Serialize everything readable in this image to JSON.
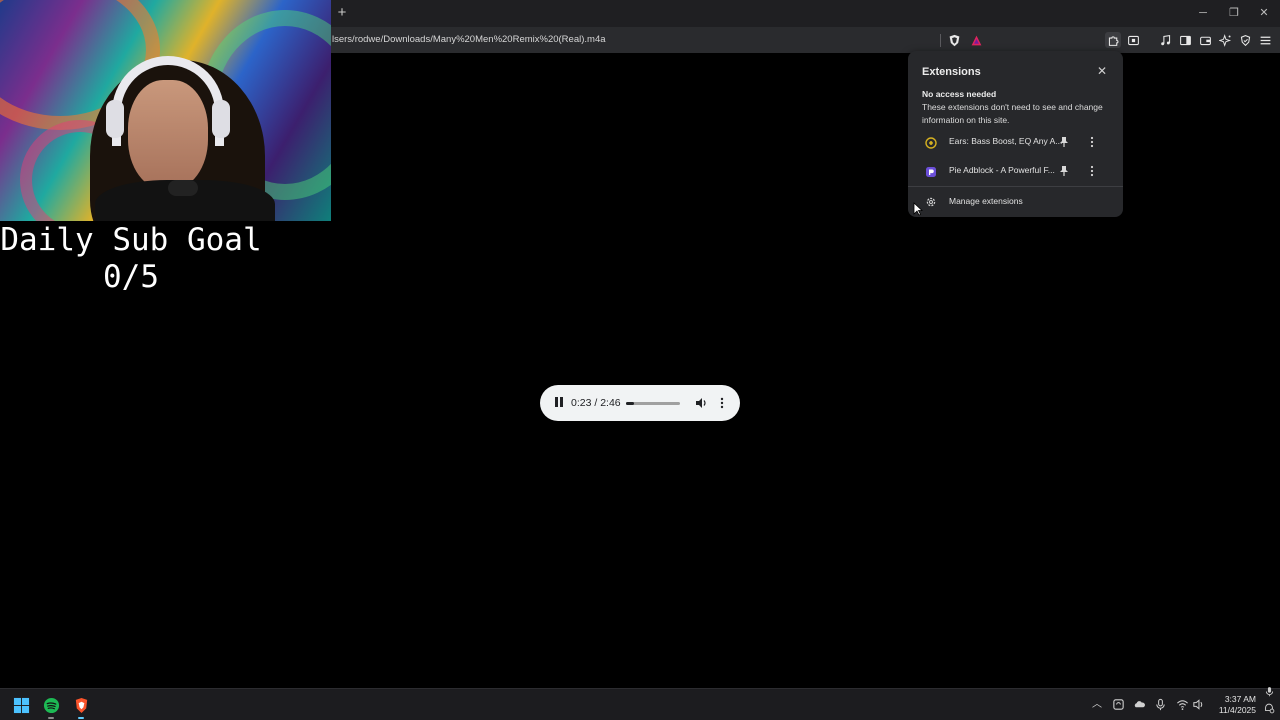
{
  "browser": {
    "new_tab_label": "+",
    "address": "lsers/rodwe/Downloads/Many%20Men%20Remix%20(Real).m4a",
    "window_controls": {
      "minimize": "─",
      "restore": "❐",
      "close": "✕"
    }
  },
  "overlay": {
    "goal_title": "Daily Sub Goal",
    "goal_count": "0/5"
  },
  "player": {
    "time": "0:23 / 2:46",
    "progress": 0.14
  },
  "extensions_panel": {
    "title": "Extensions",
    "close_label": "✕",
    "section_heading": "No access needed",
    "section_description": "These extensions don't need to see and change information on this site.",
    "items": [
      {
        "name": "Ears: Bass Boost, EQ Any A...",
        "icon": "ears-extension-icon",
        "color": "#d4b021"
      },
      {
        "name": "Pie Adblock - A Powerful F...",
        "icon": "pie-adblock-icon",
        "color": "#6b4fd8"
      }
    ],
    "manage_label": "Manage extensions"
  },
  "taskbar": {
    "apps": [
      {
        "icon": "windows-start-icon"
      },
      {
        "icon": "spotify-icon",
        "color": "#1db954"
      },
      {
        "icon": "brave-browser-icon",
        "color": "#fb542b"
      }
    ],
    "clock_time": "3:37 AM",
    "clock_date": "11/4/2025"
  },
  "colors": {
    "page_bg": "#000000",
    "panel_bg": "#27282b",
    "player_bg": "#f1f3f4"
  }
}
